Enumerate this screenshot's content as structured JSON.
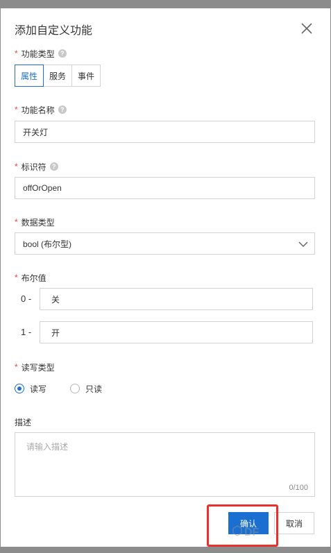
{
  "dialog": {
    "title": "添加自定义功能"
  },
  "fields": {
    "func_type": {
      "label": "功能类型",
      "options": [
        "属性",
        "服务",
        "事件"
      ],
      "selected": "属性"
    },
    "func_name": {
      "label": "功能名称",
      "value": "开关灯"
    },
    "identifier": {
      "label": "标识符",
      "value": "offOrOpen"
    },
    "data_type": {
      "label": "数据类型",
      "value": "bool (布尔型)"
    },
    "bool_value": {
      "label": "布尔值",
      "items": [
        {
          "prefix": "0 -",
          "value": "关"
        },
        {
          "prefix": "1 -",
          "value": "开"
        }
      ]
    },
    "rw_type": {
      "label": "读写类型",
      "options": [
        "读写",
        "只读"
      ],
      "selected": "读写"
    },
    "description": {
      "label": "描述",
      "placeholder": "请输入描述",
      "count": "0/100"
    }
  },
  "footer": {
    "confirm_label": "确认",
    "cancel_label": "取消"
  },
  "watermark_text": "DF",
  "colors": {
    "accent": "#1b6fd0",
    "required": "#e5483a",
    "annotation": "#e8312b"
  }
}
